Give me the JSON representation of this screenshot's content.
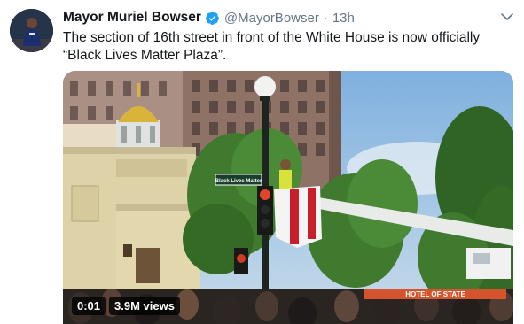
{
  "tweet": {
    "display_name": "Mayor Muriel Bowser",
    "handle": "@MayorBowser",
    "separator": "·",
    "timestamp": "13h",
    "text_line_1": "The section of 16th street in front of the White House is now officially",
    "text_line_2": "“Black Lives Matter Plaza”.",
    "verified": true
  },
  "media": {
    "sign_text": "Black Lives Matter",
    "banner_text": "HOTEL OF STATE",
    "elapsed": "0:01",
    "views": "3.9M views"
  },
  "colors": {
    "verified_blue": "#1da1f2",
    "secondary_text": "#657786",
    "primary_text": "#14171a"
  },
  "icons": {
    "verified": "verified-badge-icon",
    "menu": "chevron-down-icon"
  }
}
